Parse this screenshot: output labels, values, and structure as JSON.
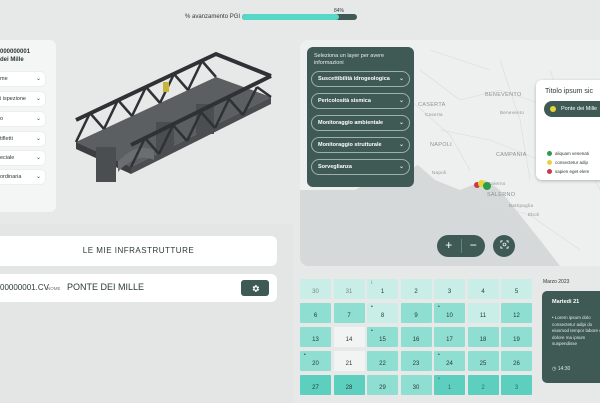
{
  "progress": {
    "label": "% avanzamento PGI",
    "percent_text": "84%",
    "percent": 84
  },
  "left_panel": {
    "bridge_code": "000000001",
    "bridge_name": "dei Mille",
    "filters": [
      "me",
      "i ispezione",
      "o",
      "tifletti",
      "eciale",
      "ordinaria"
    ]
  },
  "infra": {
    "title": "LE MIE INFRASTRUTTURE",
    "code": "00000001.CV",
    "nome_label": "NOME",
    "name": "PONTE DEI MILLE"
  },
  "map": {
    "layer_hint": "Seleziona un layer per avere informazioni",
    "layers": [
      "Suscettibilità idrogeologica",
      "Pericolosità sismica",
      "Monitoraggio ambientale",
      "Monitoraggio strutturale",
      "Sorveglianza"
    ],
    "place_labels": [
      "BENEVENTO",
      "CASERTA",
      "NAPOLI",
      "CAMPANIA",
      "SALERNO",
      "Battipaglia",
      "Benevento",
      "Caserta",
      "Eboli",
      "Napoli",
      "Salerno"
    ],
    "info_card": {
      "title": "Titolo ipsum sic",
      "pill": "Ponte dei Mille",
      "legend": [
        {
          "text": "aliquam venenati",
          "color": "#2e9b4a"
        },
        {
          "text": "consectetur adip",
          "color": "#e6d53a"
        },
        {
          "text": "sapien eget elem",
          "color": "#c93b4b"
        }
      ]
    }
  },
  "calendar": {
    "rows": [
      [
        "30",
        "31",
        "1",
        "2",
        "3",
        "4",
        "5"
      ],
      [
        "6",
        "7",
        "8",
        "9",
        "10",
        "11",
        "12"
      ],
      [
        "13",
        "14",
        "15",
        "16",
        "17",
        "18",
        "19"
      ],
      [
        "20",
        "21",
        "22",
        "23",
        "24",
        "25",
        "26"
      ],
      [
        "27",
        "28",
        "29",
        "30",
        "1",
        "2",
        "3"
      ]
    ]
  },
  "event": {
    "month": "Marzo 2023",
    "day": "Martedi 21",
    "text": "Lorem ipsum dolo consectetur adipi do eiusmod tempor labore et dolore ma ipsum suspendisse",
    "time": "14:30"
  },
  "colors": {
    "accent": "#3f5a54",
    "progress": "#57d7c6",
    "teal_light": "#c9ede7",
    "teal_mid": "#8fded2",
    "teal_strong": "#5ccfbf"
  }
}
